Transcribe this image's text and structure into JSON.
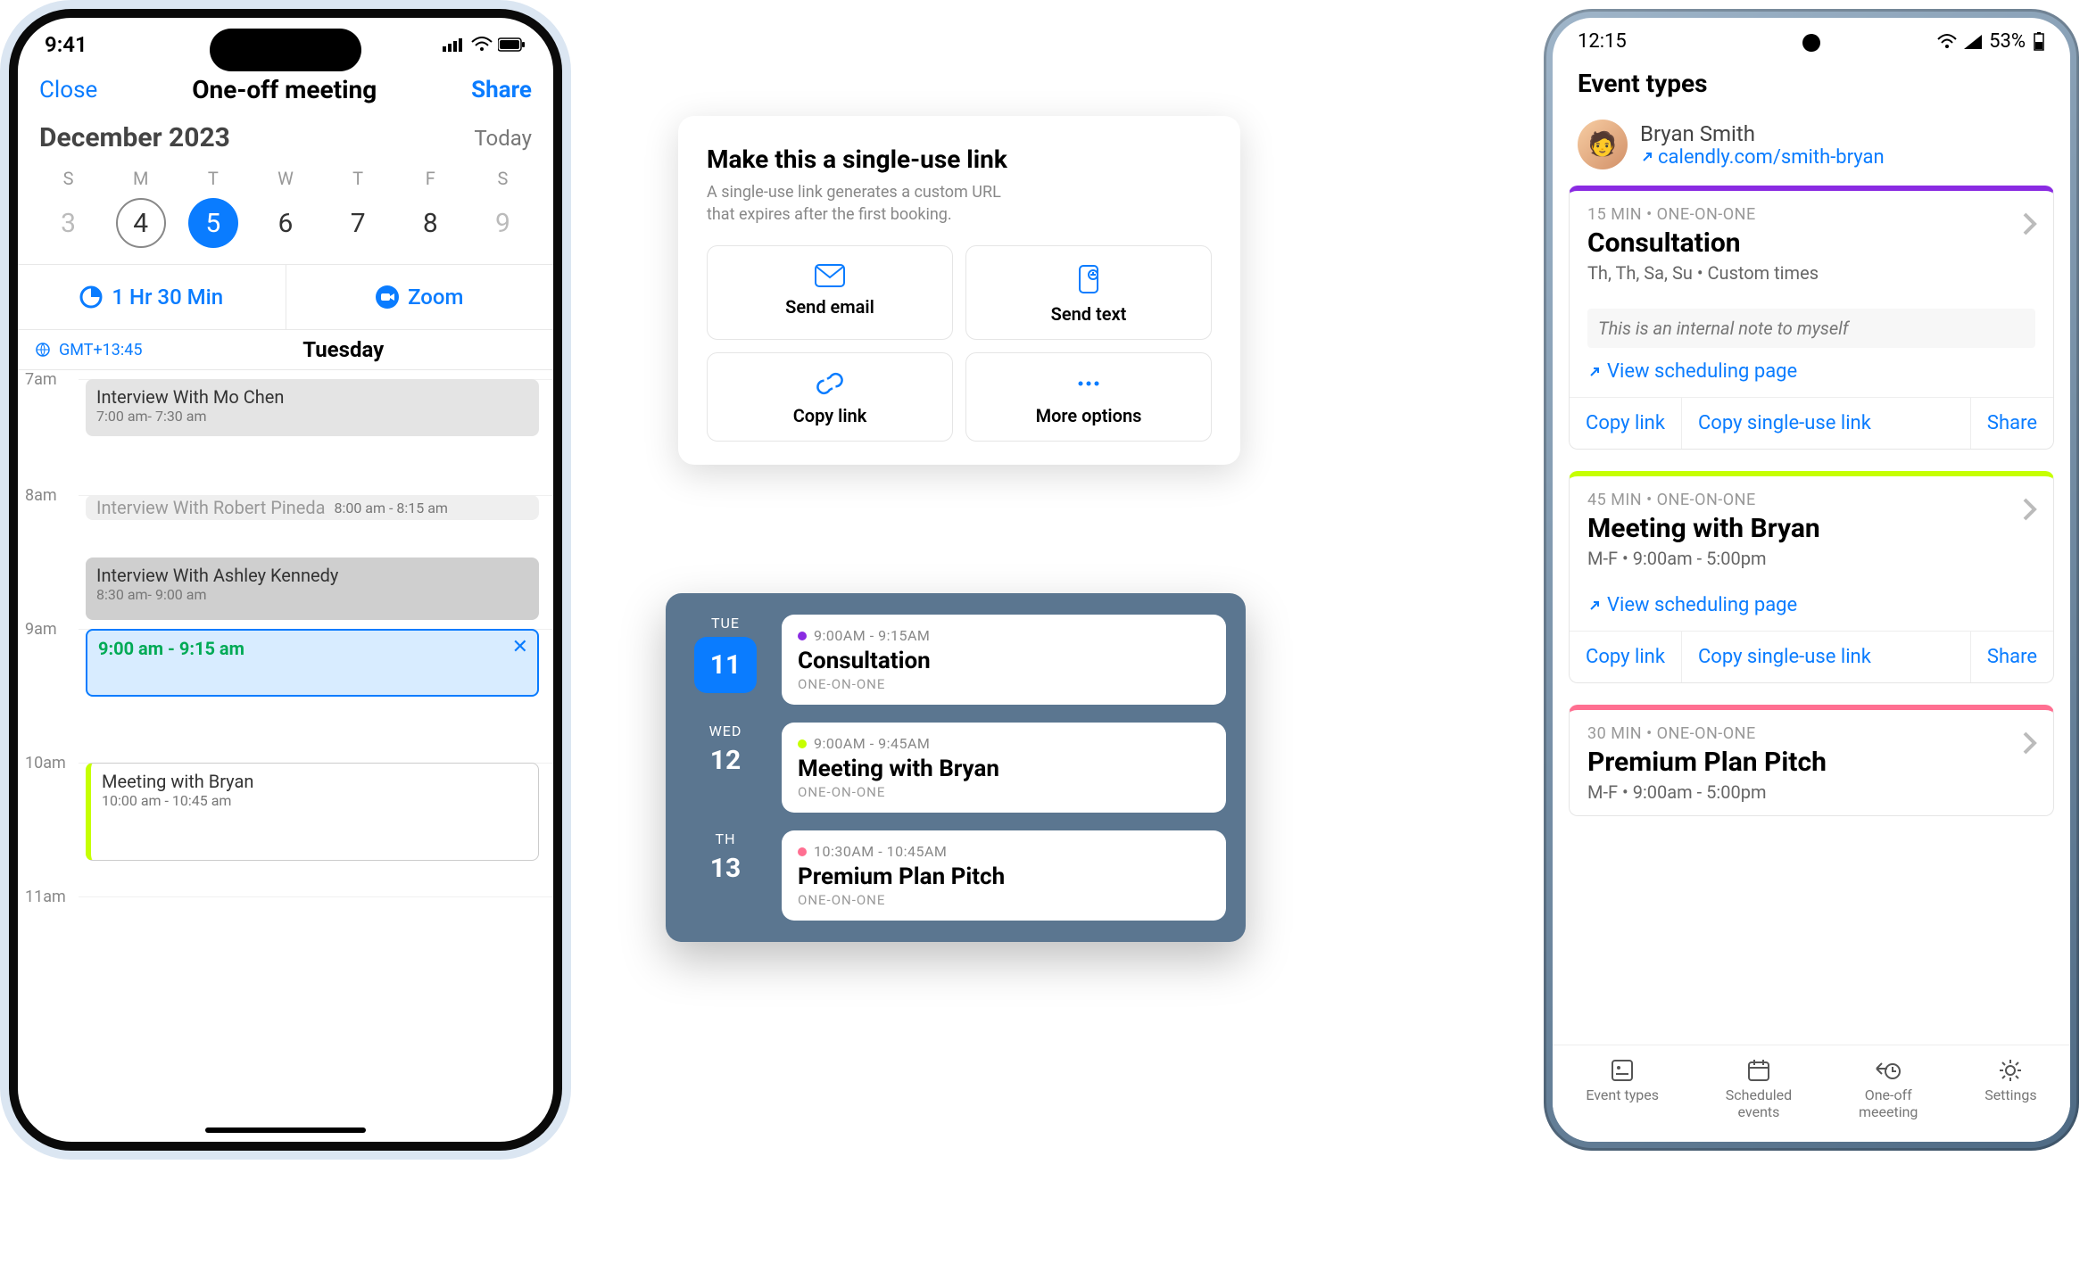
{
  "iphone": {
    "status_time": "9:41",
    "nav": {
      "close": "Close",
      "title": "One-off meeting",
      "share": "Share"
    },
    "month": "December 2023",
    "today": "Today",
    "dow": [
      "S",
      "M",
      "T",
      "W",
      "T",
      "F",
      "S"
    ],
    "dates": [
      "3",
      "4",
      "5",
      "6",
      "7",
      "8",
      "9"
    ],
    "duration": "1 Hr 30 Min",
    "location": "Zoom",
    "tz": "GMT+13:45",
    "day_name": "Tuesday",
    "hours": [
      "7am",
      "8am",
      "9am",
      "10am",
      "11am"
    ],
    "events": [
      {
        "title": "Interview With Mo Chen",
        "time": "7:00 am- 7:30 am"
      },
      {
        "title": "Interview With Robert Pineda",
        "time": "8:00 am - 8:15 am"
      },
      {
        "title": "Interview With Ashley Kennedy",
        "time": "8:30 am- 9:00 am"
      },
      {
        "title": "9:00 am - 9:15 am",
        "time": ""
      },
      {
        "title": "Meeting with Bryan",
        "time": "10:00 am - 10:45 am"
      }
    ]
  },
  "single_use": {
    "title": "Make this a single-use link",
    "desc": "A single-use link generates a custom URL that expires after the first booking.",
    "opts": [
      "Send email",
      "Send text",
      "Copy link",
      "More options"
    ]
  },
  "daylist": [
    {
      "dw": "TUE",
      "num": "11",
      "time": "9:00AM - 9:15AM",
      "name": "Consultation",
      "kind": "ONE-ON-ONE",
      "dot": "#8a2be2",
      "chip": true
    },
    {
      "dw": "WED",
      "num": "12",
      "time": "9:00AM - 9:45AM",
      "name": "Meeting with Bryan",
      "kind": "ONE-ON-ONE",
      "dot": "#c6ff00"
    },
    {
      "dw": "TH",
      "num": "13",
      "time": "10:30AM - 10:45AM",
      "name": "Premium Plan Pitch",
      "kind": "ONE-ON-ONE",
      "dot": "#ff6f91"
    }
  ],
  "android": {
    "status_time": "12:15",
    "battery": "53%",
    "header": "Event types",
    "user": {
      "name": "Bryan Smith",
      "url": "calendly.com/smith-bryan"
    },
    "view_link": "View scheduling page",
    "copy": "Copy link",
    "copy_single": "Copy single-use link",
    "share": "Share",
    "cards": [
      {
        "meta": "15 MIN • ONE-ON-ONE",
        "name": "Consultation",
        "sub": "Th, Th, Sa, Su • Custom times",
        "note": "This is an internal note to myself"
      },
      {
        "meta": "45 MIN • ONE-ON-ONE",
        "name": "Meeting with Bryan",
        "sub": "M-F • 9:00am - 5:00pm"
      },
      {
        "meta": "30 MIN • ONE-ON-ONE",
        "name": "Premium Plan Pitch",
        "sub": "M-F • 9:00am - 5:00pm"
      }
    ],
    "tabs": [
      "Event types",
      "Scheduled\nevents",
      "One-off\nmeeeting",
      "Settings"
    ]
  }
}
